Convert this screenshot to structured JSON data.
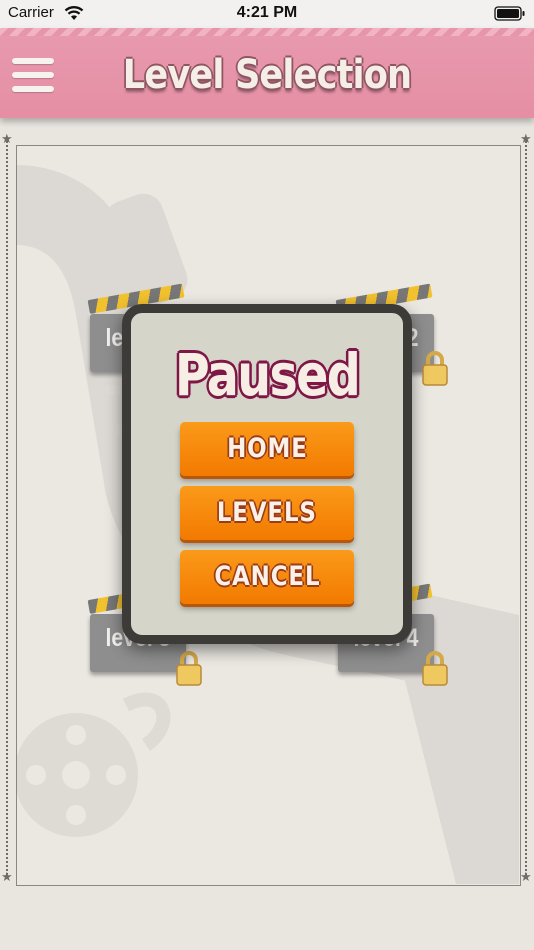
{
  "status_bar": {
    "carrier": "Carrier",
    "time": "4:21 PM"
  },
  "header": {
    "title": "Level Selection",
    "menu_icon": "hamburger-menu-icon"
  },
  "levels": [
    {
      "label": "level 1",
      "locked": false
    },
    {
      "label": "level 2",
      "locked": true
    },
    {
      "label": "level 3",
      "locked": true
    },
    {
      "label": "level 4",
      "locked": true
    }
  ],
  "pause_menu": {
    "title": "Paused",
    "buttons": {
      "home": "HOME",
      "levels": "LEVELS",
      "cancel": "CANCEL"
    }
  },
  "colors": {
    "header": "#e58ea4",
    "button": "#f7860c",
    "title_outline": "#7e1646",
    "background": "#ebe8e2"
  }
}
